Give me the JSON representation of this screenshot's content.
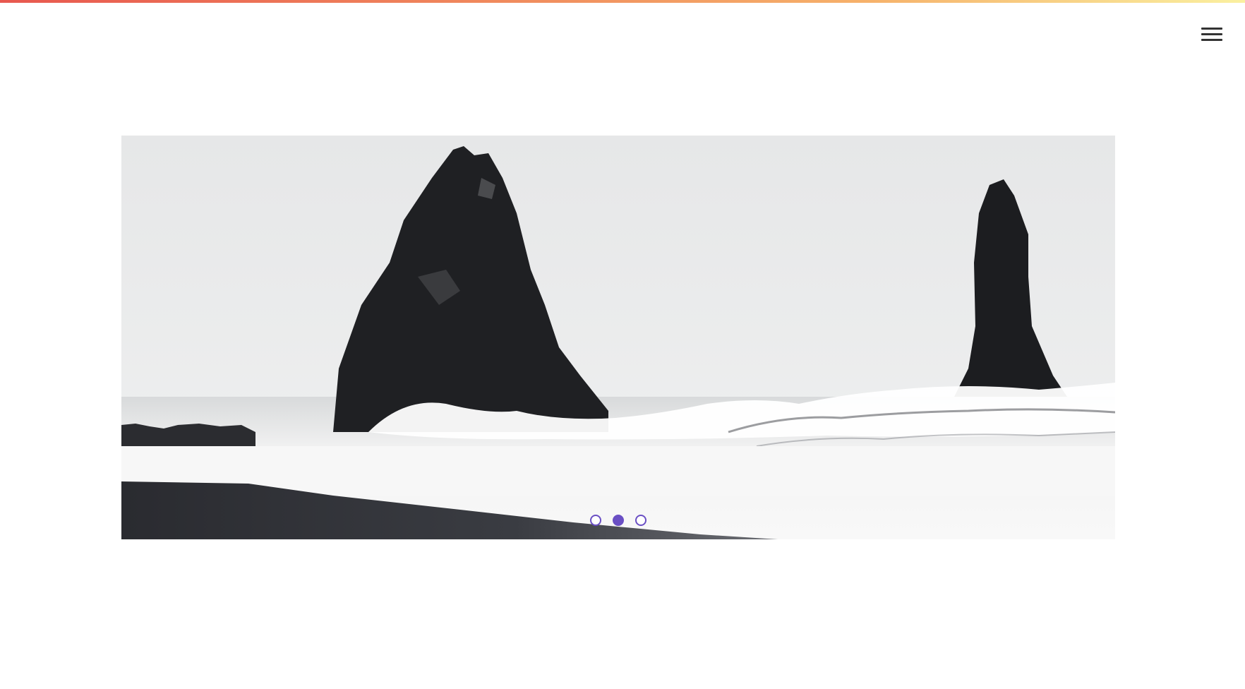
{
  "header": {
    "menu_icon": "hamburger-menu-icon"
  },
  "carousel": {
    "slide_image": "sea-stacks-beach-photo",
    "slides": [
      {
        "active": false
      },
      {
        "active": true
      },
      {
        "active": false
      }
    ],
    "active_index": 1
  },
  "colors": {
    "accent": "#6a4fc4",
    "top_bar_gradient": [
      "#e8584f",
      "#f6b26b",
      "#faf0a0"
    ],
    "menu_icon": "#333333"
  }
}
